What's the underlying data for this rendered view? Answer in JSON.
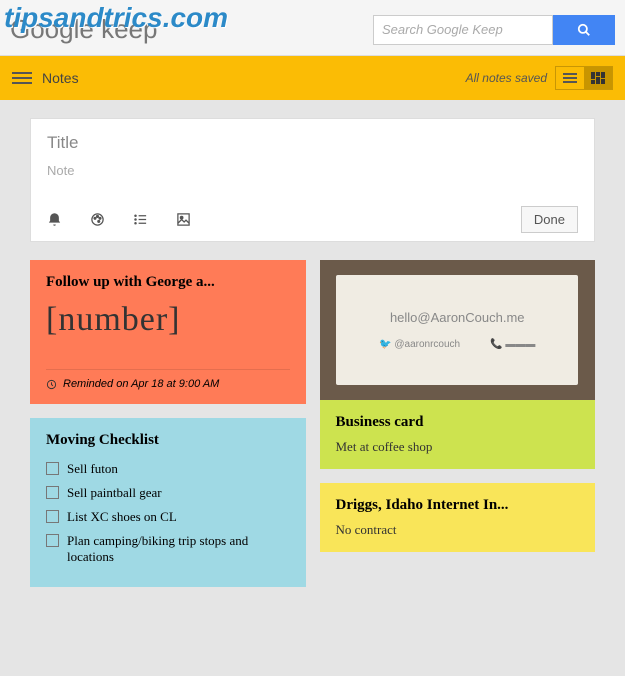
{
  "watermark": "tipsandtrics.com",
  "header": {
    "logo": "Google keep",
    "search_placeholder": "Search Google Keep"
  },
  "topbar": {
    "section": "Notes",
    "status": "All notes saved"
  },
  "composer": {
    "title_placeholder": "Title",
    "note_placeholder": "Note",
    "done_label": "Done"
  },
  "notes": {
    "followup": {
      "title": "Follow up with George a...",
      "body": "[number]",
      "reminder": "Reminded on Apr 18 at 9:00 AM"
    },
    "moving": {
      "title": "Moving Checklist",
      "items": [
        "Sell futon",
        "Sell paintball gear",
        "List XC shoes on CL",
        "Plan camping/biking trip stops and locations"
      ]
    },
    "card": {
      "email": "hello@AaronCouch.me",
      "twitter": "@aaronrcouch",
      "title": "Business card",
      "body": "Met at coffee shop"
    },
    "driggs": {
      "title": "Driggs, Idaho Internet In...",
      "body": "No contract"
    }
  }
}
